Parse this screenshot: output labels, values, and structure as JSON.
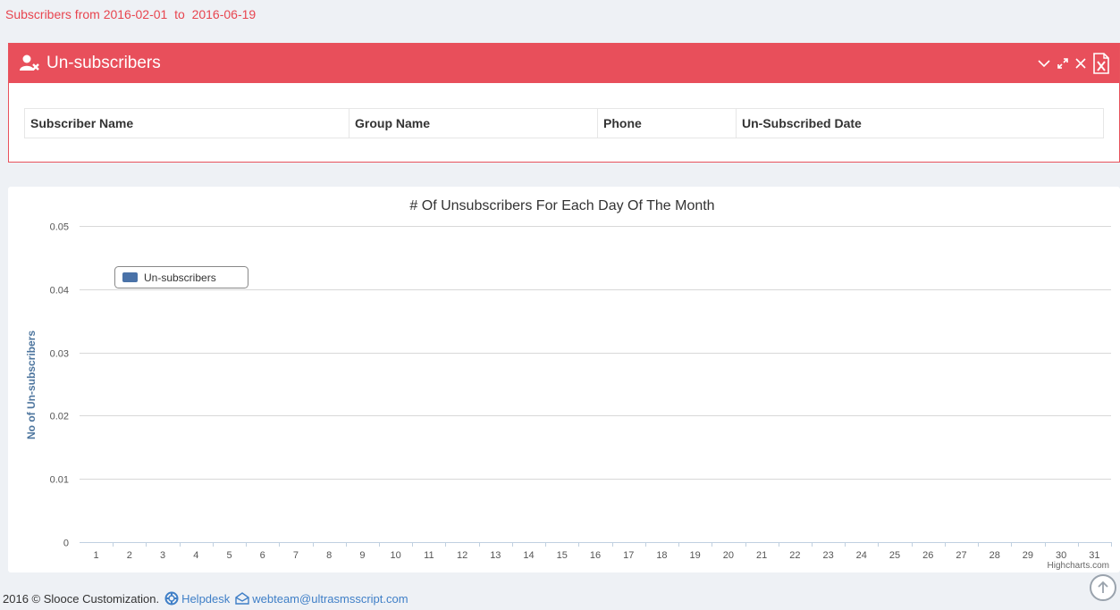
{
  "range": {
    "prefix": "Subscribers from ",
    "from": "2016-02-01",
    "to_word": "  to  ",
    "to": "2016-06-19"
  },
  "portlet": {
    "title": "Un-subscribers",
    "title_icon": "user-remove-icon",
    "tools": [
      "chevron-down-icon",
      "expand-icon",
      "close-icon",
      "excel-export-icon"
    ],
    "columns": [
      "Subscriber Name",
      "Group Name",
      "Phone",
      "Un-Subscribed Date"
    ],
    "rows": [],
    "accent": "#e84f5b"
  },
  "chart_data": {
    "type": "bar",
    "title": "# Of Unsubscribers For Each Day Of The Month",
    "xlabel": "",
    "ylabel": "No of Un-subscribers",
    "categories": [
      "1",
      "2",
      "3",
      "4",
      "5",
      "6",
      "7",
      "8",
      "9",
      "10",
      "11",
      "12",
      "13",
      "14",
      "15",
      "16",
      "17",
      "18",
      "19",
      "20",
      "21",
      "22",
      "23",
      "24",
      "25",
      "26",
      "27",
      "28",
      "29",
      "30",
      "31"
    ],
    "series": [
      {
        "name": "Un-subscribers",
        "color": "#4a72a8",
        "values": [
          0,
          0,
          0,
          0,
          0,
          0,
          0,
          0,
          0,
          0,
          0,
          0,
          0,
          0,
          0,
          0,
          0,
          0,
          0,
          0,
          0,
          0,
          0,
          0,
          0,
          0,
          0,
          0,
          0,
          0,
          0
        ]
      }
    ],
    "ylim": [
      0,
      0.05
    ],
    "yticks": [
      "0",
      "0.01",
      "0.02",
      "0.03",
      "0.04",
      "0.05"
    ],
    "grid": true,
    "legend_position": "top-left",
    "credits": "Highcharts.com"
  },
  "footer": {
    "copyright": "2016 © Slooce Customization.",
    "helpdesk": "Helpdesk",
    "email": "webteam@ultrasmsscript.com"
  }
}
